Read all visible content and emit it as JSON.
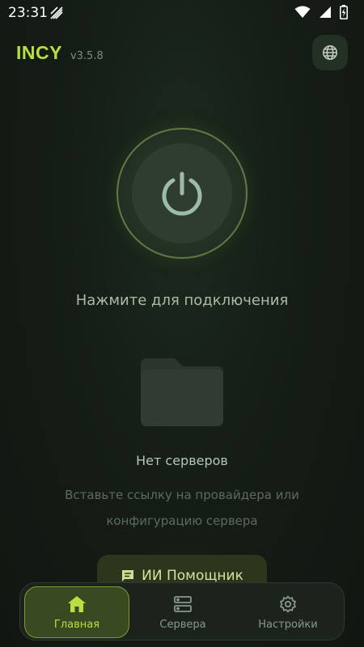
{
  "status_bar": {
    "time": "23:31"
  },
  "header": {
    "title": "INCY",
    "version": "v3.5.8"
  },
  "main": {
    "connect_hint": "Нажмите для подключения",
    "empty_title": "Нет серверов",
    "empty_desc": "Вставьте ссылку на провайдера или конфигурацию сервера",
    "assistant_label": "ИИ Помощник"
  },
  "nav": {
    "items": [
      {
        "label": "Главная",
        "icon": "home-icon",
        "active": true
      },
      {
        "label": "Сервера",
        "icon": "servers-icon",
        "active": false
      },
      {
        "label": "Настройки",
        "icon": "settings-icon",
        "active": false
      }
    ]
  },
  "colors": {
    "accent": "#b8df3f",
    "background": "#151d16",
    "power_icon": "#9cbba8"
  }
}
